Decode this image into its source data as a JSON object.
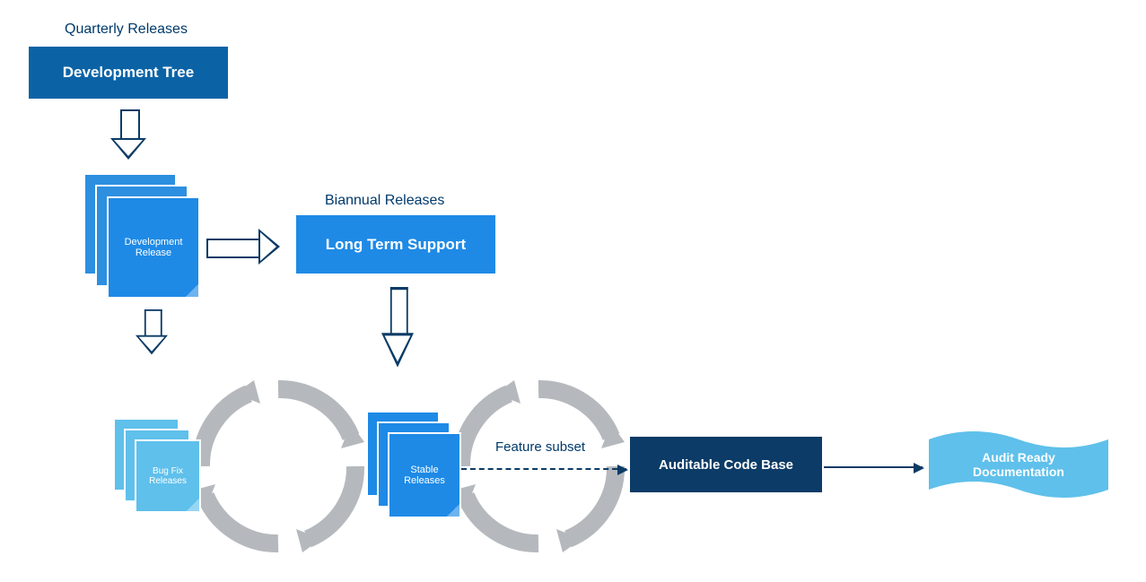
{
  "headers": {
    "quarterly": "Quarterly Releases",
    "biannual": "Biannual Releases"
  },
  "nodes": {
    "dev_tree": "Development Tree",
    "lts": "Long Term Support",
    "auditable": "Auditable Code Base",
    "audit_doc": "Audit Ready Documentation"
  },
  "cards": {
    "dev_release": "Development Release",
    "bugfix_release": "Bug Fix Releases",
    "stable_release": "Stable Releases"
  },
  "labels": {
    "feature_subset": "Feature subset"
  }
}
